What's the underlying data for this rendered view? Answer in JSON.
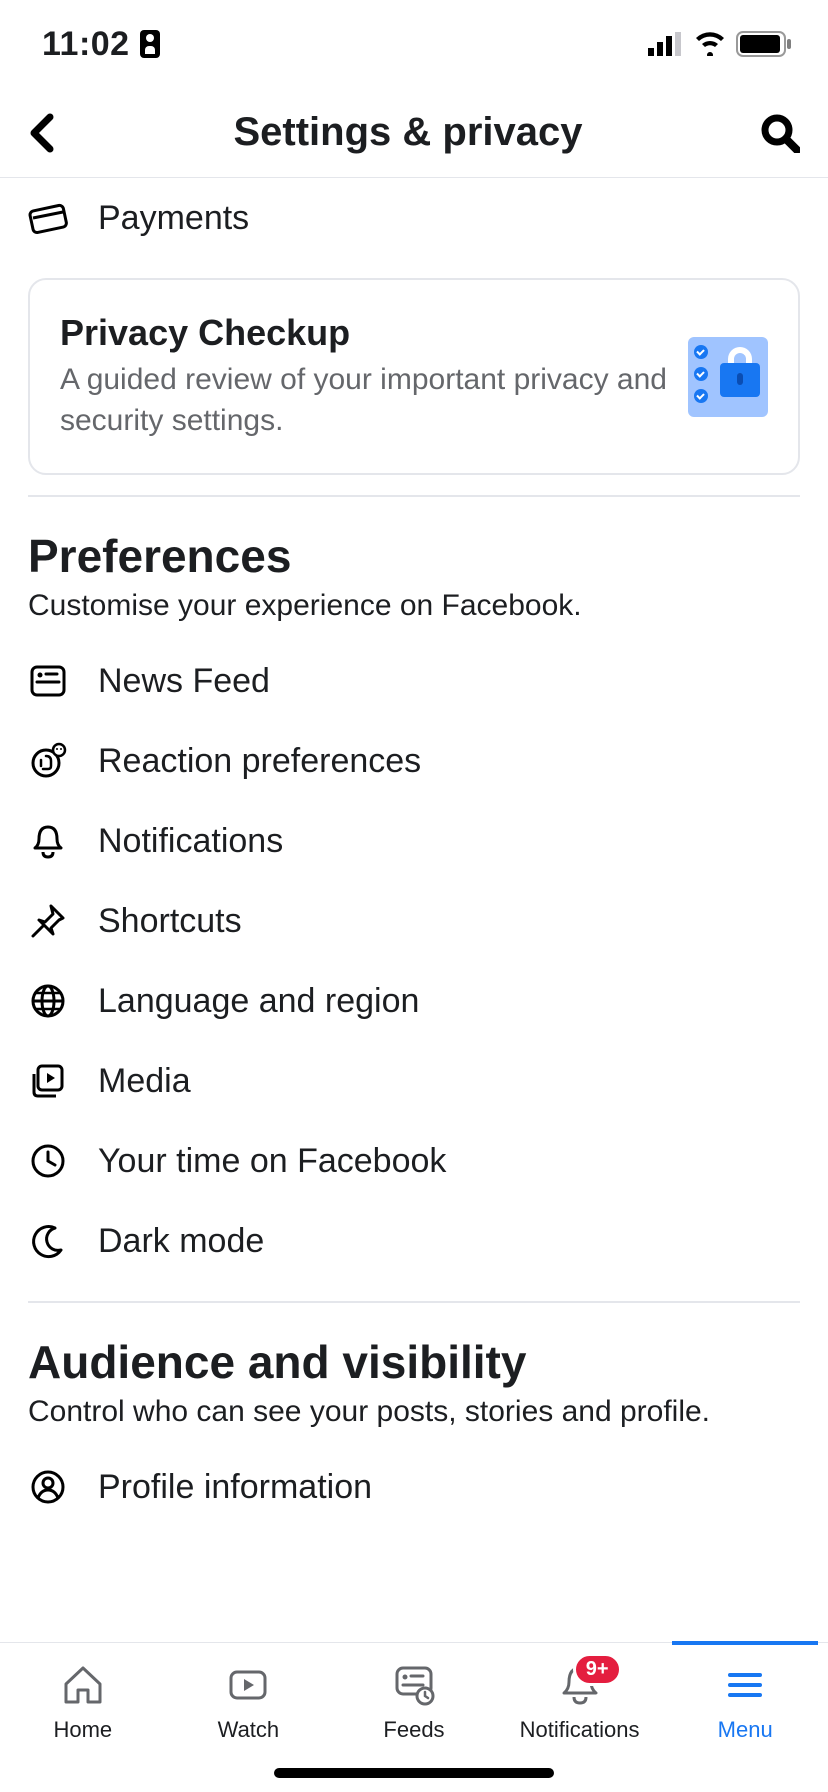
{
  "status": {
    "time": "11:02"
  },
  "header": {
    "title": "Settings & privacy"
  },
  "top_row": {
    "label": "Payments"
  },
  "card": {
    "title": "Privacy Checkup",
    "subtitle": "A guided review of your important privacy and security settings."
  },
  "preferences": {
    "title": "Preferences",
    "subtitle": "Customise your experience on Facebook.",
    "items": [
      "News Feed",
      "Reaction preferences",
      "Notifications",
      "Shortcuts",
      "Language and region",
      "Media",
      "Your time on Facebook",
      "Dark mode"
    ]
  },
  "audience": {
    "title": "Audience and visibility",
    "subtitle": "Control who can see your posts, stories and profile.",
    "items": [
      "Profile information"
    ]
  },
  "tabs": {
    "home": "Home",
    "watch": "Watch",
    "feeds": "Feeds",
    "notifications": "Notifications",
    "menu": "Menu",
    "badge": "9+"
  }
}
